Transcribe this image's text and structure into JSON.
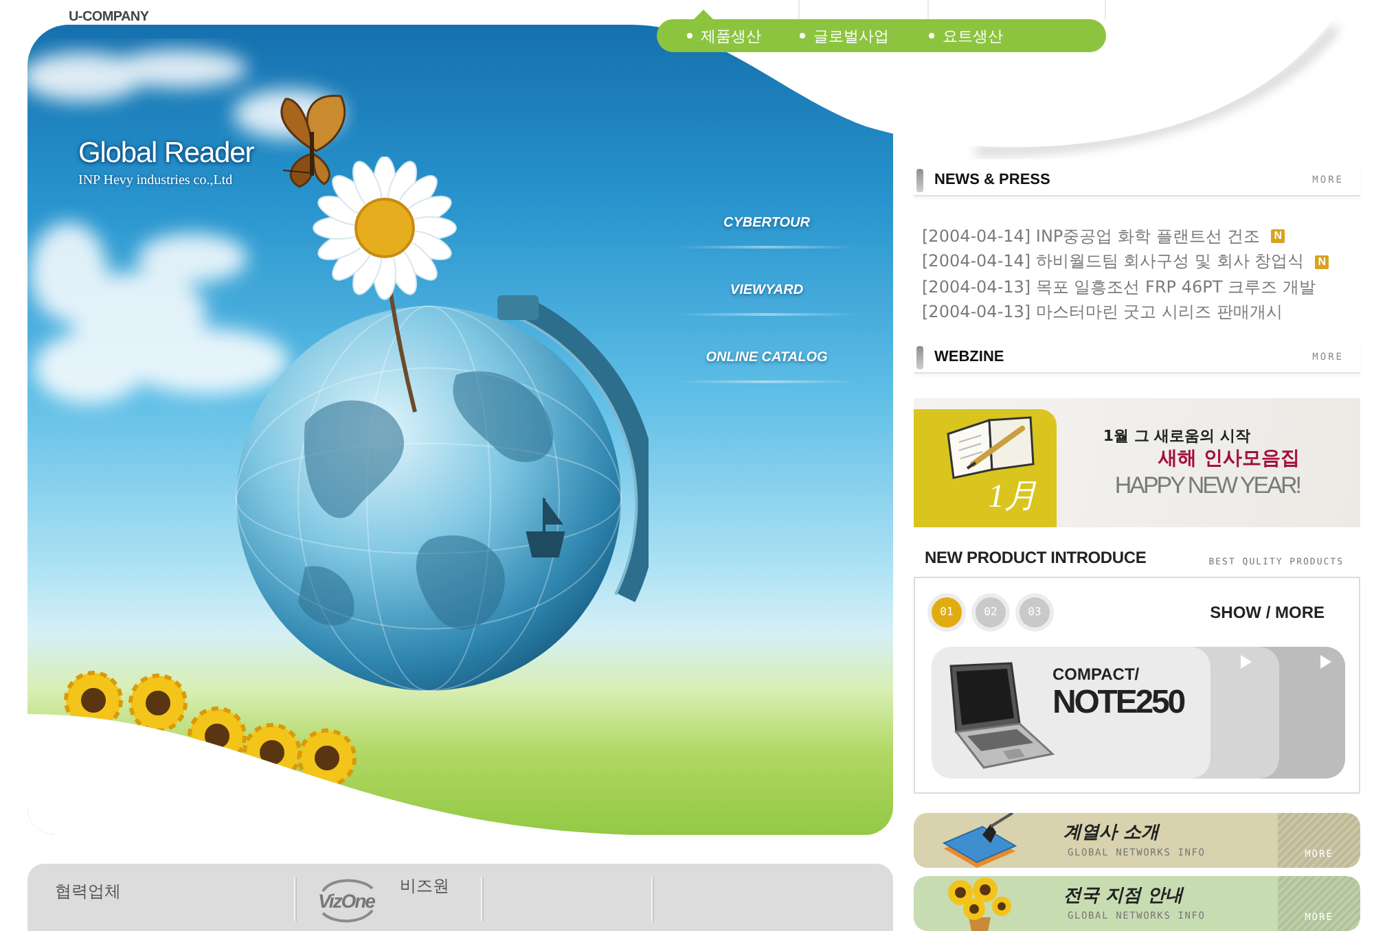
{
  "logo": {
    "text": "U-COMPANY"
  },
  "top_nav": {
    "items": [
      {
        "label": "제품생산",
        "selected": true
      },
      {
        "label": "글로벌사업",
        "selected": false
      },
      {
        "label": "요트생산",
        "selected": false
      }
    ]
  },
  "hero": {
    "title": "Global Reader",
    "subtitle": "INP Hevy industries co.,Ltd",
    "links": [
      "CYBERTOUR",
      "VIEWYARD",
      "ONLINE CATALOG"
    ]
  },
  "news": {
    "title": "NEWS & PRESS",
    "more": "MORE",
    "items": [
      {
        "text": "[2004-04-14] INP중공업 화학 플랜트선 건조",
        "badge": "N"
      },
      {
        "text": "[2004-04-14] 하비월드팀 회사구성 및 회사 창업식",
        "badge": "N"
      },
      {
        "text": "[2004-04-13] 목포 일흥조선 FRP 46PT 크루즈 개발"
      },
      {
        "text": "[2004-04-13] 마스터마린 굿고 시리즈 판매개시"
      }
    ]
  },
  "webzine": {
    "title": "WEBZINE",
    "more": "MORE",
    "banner": {
      "month": "1月",
      "kicker": "1월 그 새로움의 시작",
      "headline": "새해 인사모음집",
      "english": "HAPPY NEW YEAR!"
    }
  },
  "new_product": {
    "title": "NEW PRODUCT INTRODUCE",
    "tagline": "BEST QULITY PRODUCTS",
    "pages": [
      {
        "label": "01",
        "selected": true
      },
      {
        "label": "02",
        "selected": false
      },
      {
        "label": "03",
        "selected": false
      }
    ],
    "show_more": "SHOW / MORE",
    "product": {
      "line1": "COMPACT/",
      "model": "NOTE250"
    }
  },
  "banners": [
    {
      "kind": "book",
      "title": "계열사 소개",
      "subtitle": "GLOBAL NETWORKS INFO",
      "more": "MORE",
      "color": "#d8d2ae"
    },
    {
      "kind": "flowers",
      "title": "전국 지점 안내",
      "subtitle": "GLOBAL NETWORKS INFO",
      "more": "MORE",
      "color": "#c8dcb2"
    }
  ],
  "partners": {
    "label": "협력업체",
    "logo_text": "VizOne",
    "name": "비즈원"
  }
}
